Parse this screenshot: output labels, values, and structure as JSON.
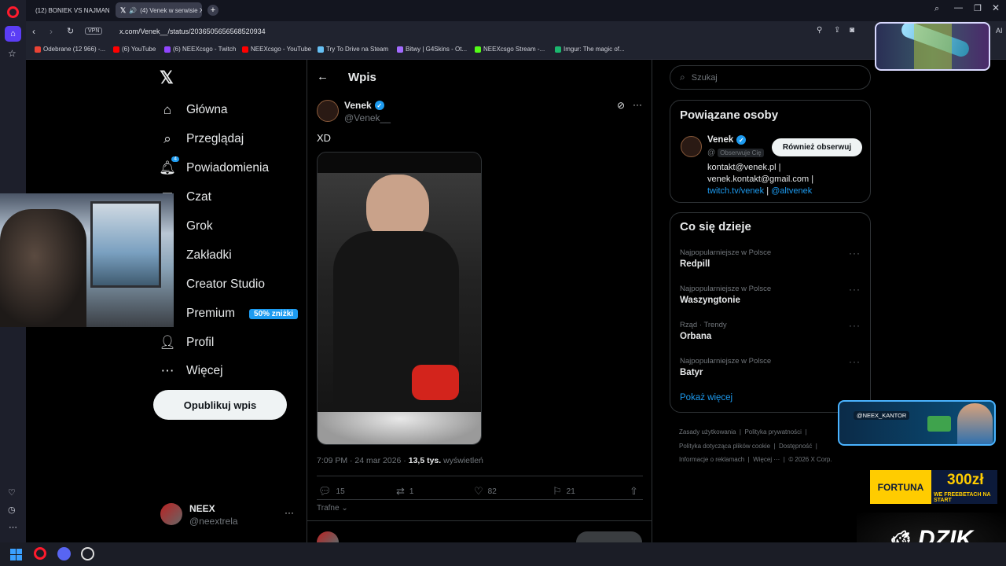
{
  "browser": {
    "tabs": [
      {
        "title": "(12) BONIEK VS NAJMAN"
      },
      {
        "title": "(4) Venek w serwisie X"
      }
    ],
    "url": "x.com/Venek__/status/2036505656568520934",
    "vpn_label": "VPN",
    "ai_label": "AI",
    "bookmarks": [
      {
        "label": "Odebrane (12 966) -..."
      },
      {
        "label": "(6) YouTube"
      },
      {
        "label": "(6) NEEXcsgo - Twitch"
      },
      {
        "label": "NEEXcsgo - YouTube"
      },
      {
        "label": "Try To Drive na Steam"
      },
      {
        "label": "Bitwy | G4Skins - Ot..."
      },
      {
        "label": "NEEXcsgo Stream -..."
      },
      {
        "label": "Imgur: The magic of..."
      }
    ]
  },
  "nav": {
    "items": [
      {
        "label": "Główna",
        "icon": "home-icon"
      },
      {
        "label": "Przeglądaj",
        "icon": "search-icon"
      },
      {
        "label": "Powiadomienia",
        "icon": "bell-icon",
        "badge": "4"
      },
      {
        "label": "Czat",
        "icon": "mail-icon"
      },
      {
        "label": "Grok",
        "icon": "grok-icon"
      },
      {
        "label": "Zakładki",
        "icon": "bookmark-icon"
      },
      {
        "label": "Creator Studio",
        "icon": "creator-icon"
      },
      {
        "label": "Premium",
        "icon": "premium-icon",
        "pill": "50% zniżki"
      },
      {
        "label": "Profil",
        "icon": "person-icon"
      },
      {
        "label": "Więcej",
        "icon": "more-icon"
      }
    ],
    "publish_label": "Opublikuj wpis",
    "account": {
      "name": "NEEX",
      "handle": "@neextrela"
    }
  },
  "post": {
    "header_title": "Wpis",
    "author_name": "Venek",
    "author_handle": "@Venek__",
    "text": "XD",
    "time": "7:09 PM · 24 mar 2026 · ",
    "views_count": "13,5 tys.",
    "views_label": " wyświetleń",
    "replies": "15",
    "reposts": "1",
    "likes": "82",
    "bookmarks": "21",
    "sort_label": "Trafne"
  },
  "sidebar": {
    "search_placeholder": "Szukaj",
    "related_title": "Powiązane osoby",
    "related_person": {
      "name": "Venek",
      "handle": "@",
      "follows_you": "Obserwuje Cię",
      "follow_back": "Również obserwuj",
      "bio_line1": "kontakt@venek.pl |",
      "bio_line2": "venek.kontakt@gmail.com |",
      "bio_link1": "twitch.tv/venek",
      "bio_sep": " | ",
      "bio_link2": "@altvenek"
    },
    "trends_title": "Co się dzieje",
    "trends": [
      {
        "context": "Najpopularniejsze w Polsce",
        "name": "Redpill"
      },
      {
        "context": "Najpopularniejsze w Polsce",
        "name": "Waszyngtonie"
      },
      {
        "context": "Rząd · Trendy",
        "name": "Orbana"
      },
      {
        "context": "Najpopularniejsze w Polsce",
        "name": "Batyr"
      }
    ],
    "show_more": "Pokaż więcej",
    "footer": [
      "Zasady użytkowania",
      "Polityka prywatności",
      "Polityka dotycząca plików cookie",
      "Dostępność",
      "Informacje o reklamach",
      "Więcej ···",
      "© 2026 X Corp."
    ]
  },
  "overlays": {
    "kantor_handle": "@NEEX_KANTOR",
    "fortuna_brand": "FORTUNA",
    "fortuna_amount": "300zł",
    "fortuna_sub": "WE FREEBETACH NA START",
    "dzik": "DZIK"
  },
  "colors": {
    "accent": "#1d9bf0",
    "background": "#000000"
  }
}
